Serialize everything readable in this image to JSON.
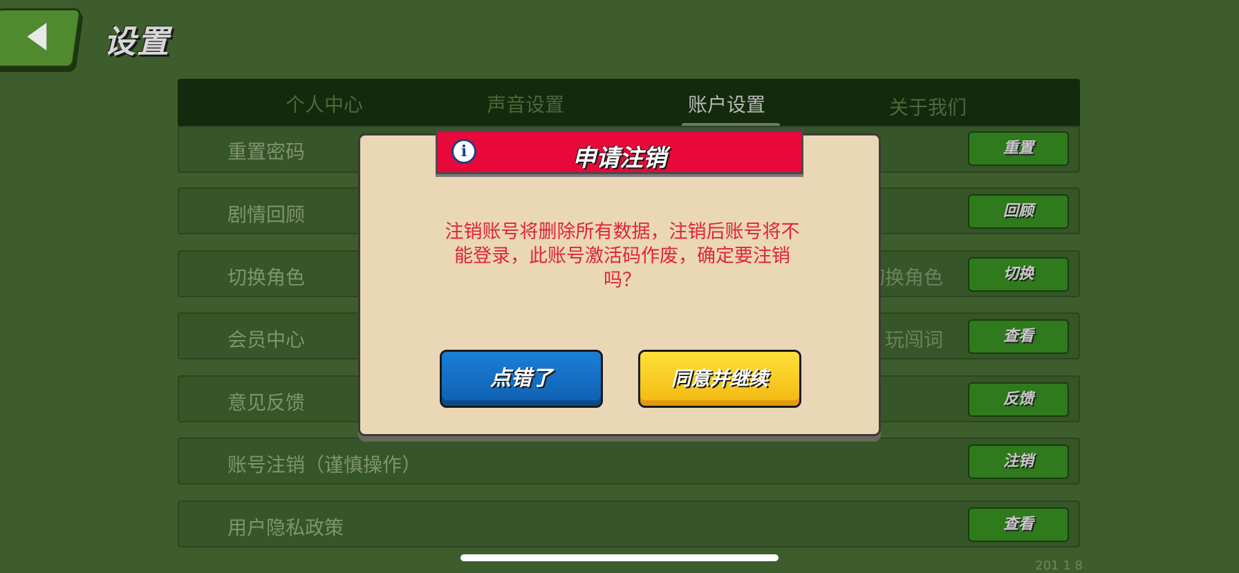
{
  "header": {
    "title": "设置",
    "back_icon": "back-arrow-icon"
  },
  "tabs": [
    {
      "label": "个人中心",
      "active": false
    },
    {
      "label": "声音设置",
      "active": false
    },
    {
      "label": "账户设置",
      "active": true
    },
    {
      "label": "关于我们",
      "active": false
    }
  ],
  "rows": [
    {
      "label": "重置密码",
      "desc": "",
      "button": "重置"
    },
    {
      "label": "剧情回顾",
      "desc": "",
      "button": "回顾"
    },
    {
      "label": "切换角色",
      "desc": "切换角色",
      "button": "切换"
    },
    {
      "label": "会员中心",
      "desc": "玩闯词",
      "button": "查看"
    },
    {
      "label": "意见反馈",
      "desc": "",
      "button": "反馈"
    },
    {
      "label": "账号注销（谨慎操作）",
      "desc": "",
      "button": "注销"
    },
    {
      "label": "用户隐私政策",
      "desc": "",
      "button": "查看"
    }
  ],
  "dialog": {
    "title": "申请注销",
    "icon": "info-icon",
    "message": "注销账号将删除所有数据，注销后账号将不能登录，此账号激活码作废，确定要注销吗？",
    "cancel_label": "点错了",
    "confirm_label": "同意并继续"
  },
  "footer": {
    "version": "201  1  8"
  },
  "colors": {
    "background": "#3d5e2c",
    "dialog_header": "#e8083a",
    "cancel_button": "#1a7fd6",
    "confirm_button": "#ffe03a",
    "message_text": "#e0243a"
  }
}
